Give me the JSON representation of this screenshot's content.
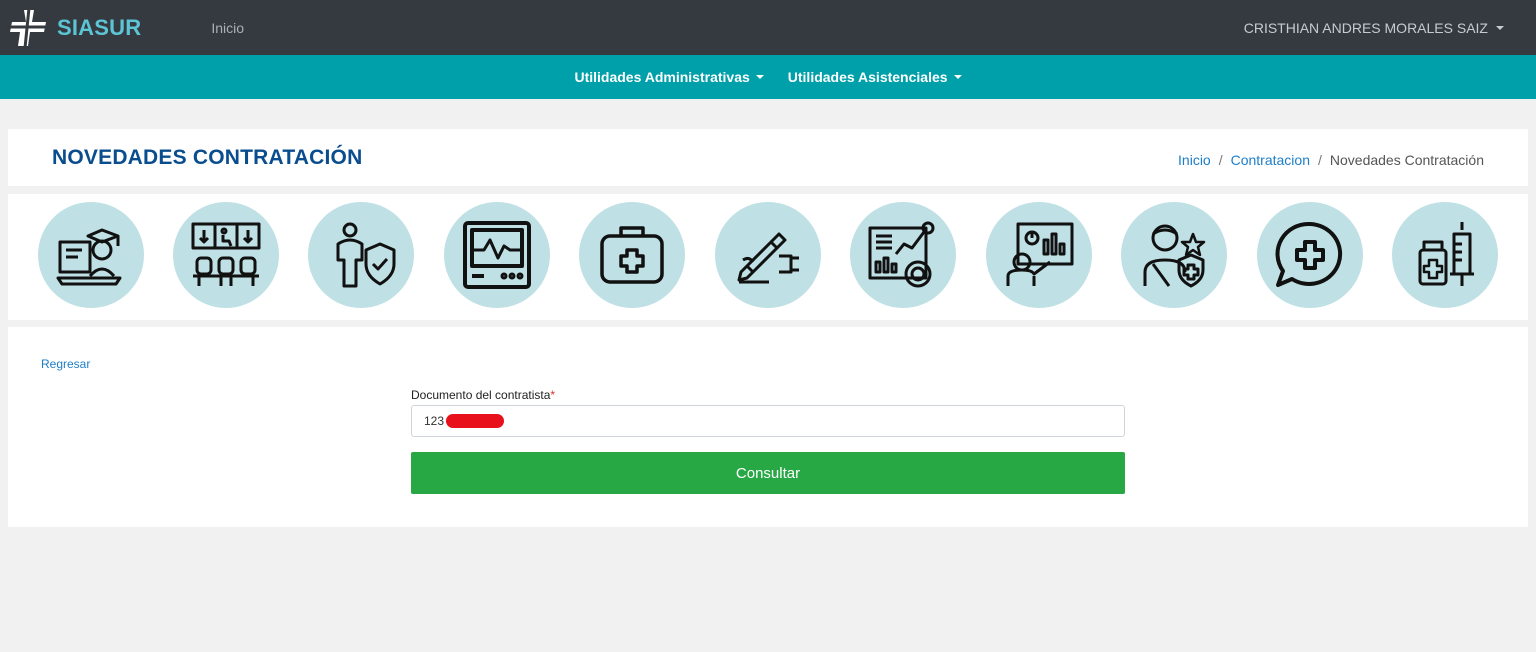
{
  "app": {
    "name": "SIASUR",
    "nav_home": "Inicio",
    "user_name": "CRISTHIAN ANDRES MORALES SAIZ",
    "brand_color": "#5cc4d4",
    "topbar_color": "#343a40",
    "accent_color": "#00a0aa"
  },
  "submenu": {
    "items": [
      {
        "label": "Utilidades Administrativas"
      },
      {
        "label": "Utilidades Asistenciales"
      }
    ]
  },
  "header": {
    "title": "NOVEDADES CONTRATACIÓN",
    "breadcrumb": [
      {
        "label": "Inicio"
      },
      {
        "label": "Contratacion"
      },
      {
        "label": "Novedades Contratación"
      }
    ]
  },
  "modules": [
    {
      "icon": "online-education-icon"
    },
    {
      "icon": "waiting-room-icon"
    },
    {
      "icon": "insurance-shield-person-icon"
    },
    {
      "icon": "heart-monitor-icon"
    },
    {
      "icon": "first-aid-kit-icon"
    },
    {
      "icon": "signing-contract-icon"
    },
    {
      "icon": "analytics-dashboard-icon"
    },
    {
      "icon": "presentation-teacher-icon"
    },
    {
      "icon": "injured-patient-shield-icon"
    },
    {
      "icon": "medical-chat-icon"
    },
    {
      "icon": "medication-syringe-icon"
    }
  ],
  "form": {
    "back_label": "Regresar",
    "document_label": "Documento del contratista",
    "required_mark": "*",
    "document_value": "123",
    "submit_label": "Consultar",
    "submit_color": "#28a745"
  }
}
